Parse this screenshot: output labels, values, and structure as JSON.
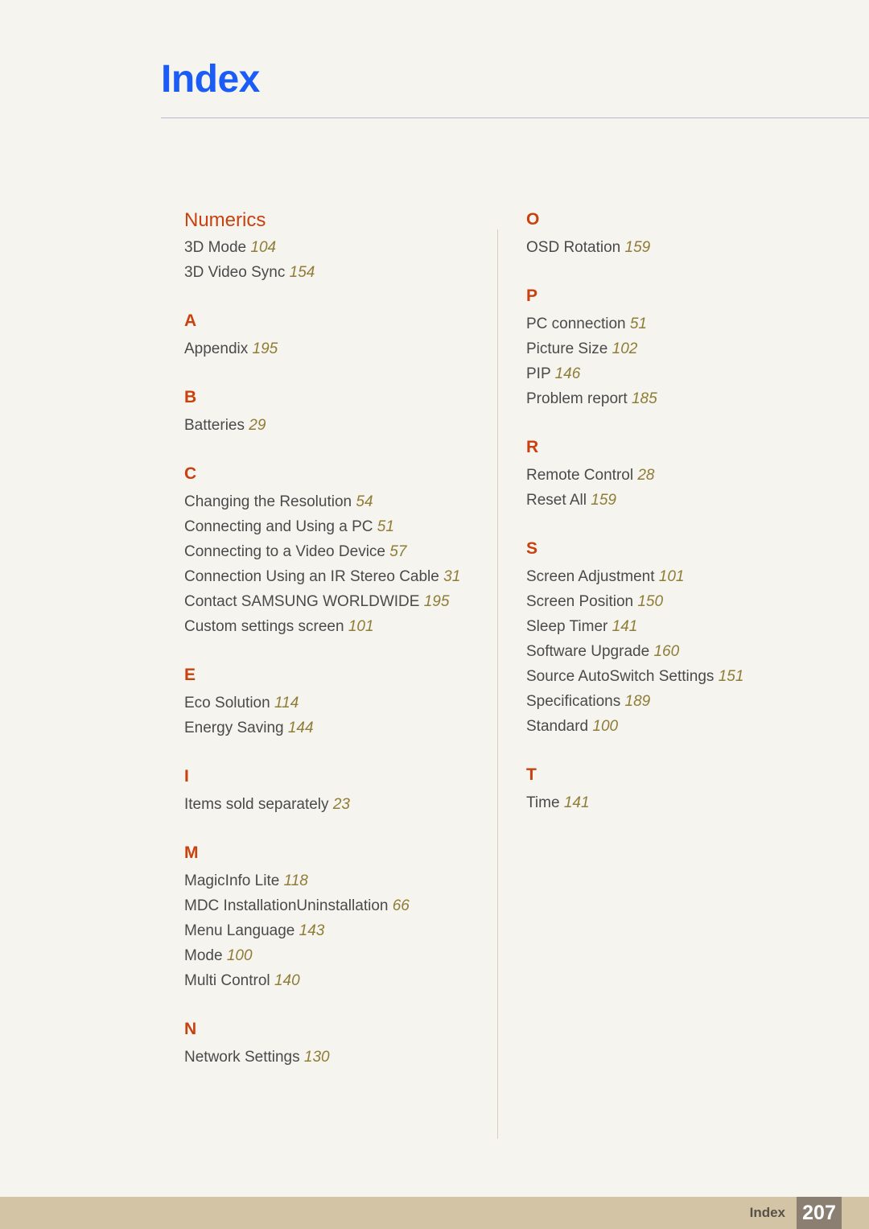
{
  "header": {
    "title": "Index"
  },
  "footer": {
    "label": "Index",
    "page_number": "207"
  },
  "colors": {
    "background": "#f6f4ee",
    "title_blue": "#1a5cf5",
    "section_orange": "#c8410e",
    "entry_text": "#4a4a4a",
    "page_number_olive": "#8f7c37",
    "header_rule": "#b9b6d4",
    "column_divider": "#e0c9bd",
    "footer_bar": "#d2c4a5",
    "footer_badge": "#8a7f70"
  },
  "columns": [
    {
      "id": "left",
      "sections": [
        {
          "letter": "Numerics",
          "is_numerics": true,
          "entries": [
            {
              "title": "3D Mode",
              "page": "104"
            },
            {
              "title": "3D Video Sync",
              "page": "154"
            }
          ]
        },
        {
          "letter": "A",
          "entries": [
            {
              "title": "Appendix",
              "page": "195"
            }
          ]
        },
        {
          "letter": "B",
          "entries": [
            {
              "title": "Batteries",
              "page": "29"
            }
          ]
        },
        {
          "letter": "C",
          "entries": [
            {
              "title": "Changing the Resolution",
              "page": "54"
            },
            {
              "title": "Connecting and Using a PC",
              "page": "51"
            },
            {
              "title": "Connecting to a Video Device",
              "page": "57"
            },
            {
              "title": "Connection Using an IR Stereo Cable",
              "page": "31"
            },
            {
              "title": "Contact SAMSUNG WORLDWIDE",
              "page": "195"
            },
            {
              "title": "Custom settings screen",
              "page": "101"
            }
          ]
        },
        {
          "letter": "E",
          "entries": [
            {
              "title": "Eco Solution",
              "page": "114"
            },
            {
              "title": "Energy Saving",
              "page": "144"
            }
          ]
        },
        {
          "letter": "I",
          "entries": [
            {
              "title": "Items sold separately",
              "page": "23"
            }
          ]
        },
        {
          "letter": "M",
          "entries": [
            {
              "title": "MagicInfo Lite",
              "page": "118"
            },
            {
              "title": "MDC InstallationUninstallation",
              "page": "66"
            },
            {
              "title": "Menu Language",
              "page": "143"
            },
            {
              "title": "Mode",
              "page": "100"
            },
            {
              "title": "Multi Control",
              "page": "140"
            }
          ]
        },
        {
          "letter": "N",
          "entries": [
            {
              "title": "Network Settings",
              "page": "130"
            }
          ]
        }
      ]
    },
    {
      "id": "right",
      "sections": [
        {
          "letter": "O",
          "entries": [
            {
              "title": "OSD Rotation",
              "page": "159"
            }
          ]
        },
        {
          "letter": "P",
          "entries": [
            {
              "title": "PC connection",
              "page": "51"
            },
            {
              "title": "Picture Size",
              "page": "102"
            },
            {
              "title": "PIP",
              "page": "146"
            },
            {
              "title": "Problem report",
              "page": "185"
            }
          ]
        },
        {
          "letter": "R",
          "entries": [
            {
              "title": "Remote Control",
              "page": "28"
            },
            {
              "title": "Reset All",
              "page": "159"
            }
          ]
        },
        {
          "letter": "S",
          "entries": [
            {
              "title": "Screen Adjustment",
              "page": "101"
            },
            {
              "title": "Screen Position",
              "page": "150"
            },
            {
              "title": "Sleep Timer",
              "page": "141"
            },
            {
              "title": "Software Upgrade",
              "page": "160"
            },
            {
              "title": "Source AutoSwitch Settings",
              "page": "151"
            },
            {
              "title": "Specifications",
              "page": "189"
            },
            {
              "title": "Standard",
              "page": "100"
            }
          ]
        },
        {
          "letter": "T",
          "entries": [
            {
              "title": "Time",
              "page": "141"
            }
          ]
        }
      ]
    }
  ]
}
